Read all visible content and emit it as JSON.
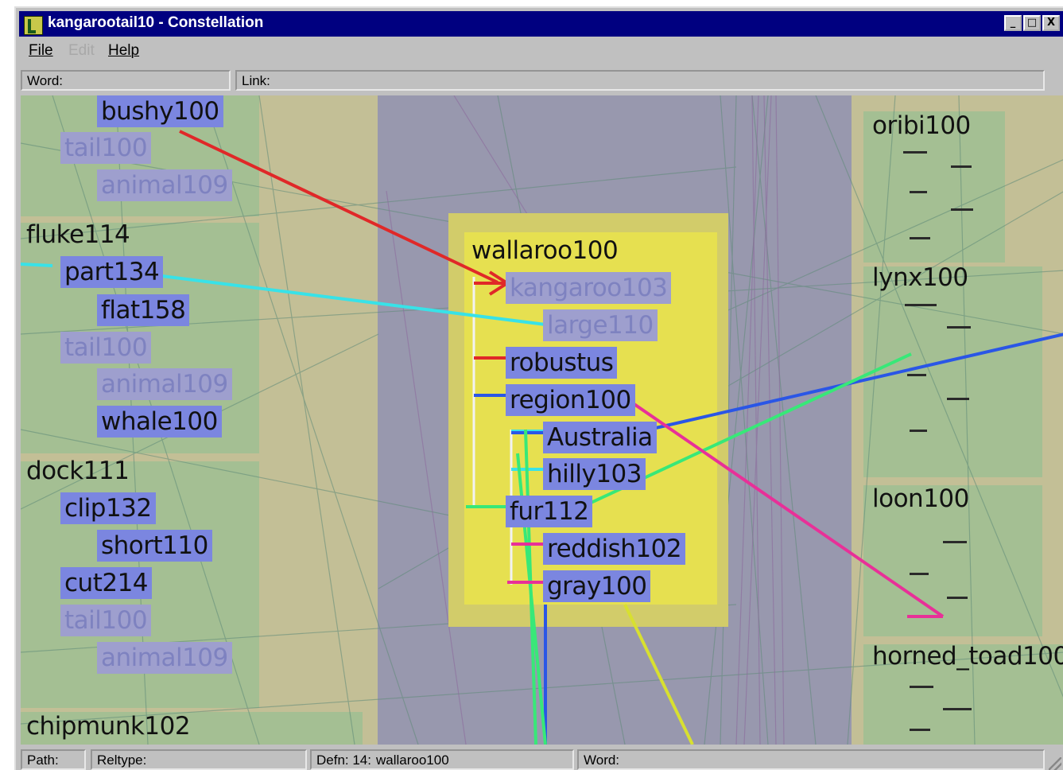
{
  "window": {
    "title": "kangarootail10 - Constellation",
    "controls": {
      "minimize": "_",
      "maximize": "□",
      "close": "X"
    }
  },
  "menubar": {
    "file": "File",
    "edit": "Edit",
    "help": "Help"
  },
  "fields": {
    "word_label": "Word:",
    "word_value": "",
    "link_label": "Link:",
    "link_value": ""
  },
  "canvas": {
    "colors": {
      "background": "#c3bf96",
      "center_panel": "#9898ae",
      "focus_outer": "#d2cc6a",
      "focus_inner": "#e6e050",
      "node_fill": "#7b86e0",
      "line_red": "#e02828",
      "line_cyan": "#38e2e8",
      "line_blue": "#2a56e6",
      "line_green": "#38e878",
      "line_magenta": "#e83098",
      "line_yellow": "#d8e030"
    },
    "left_nodes": {
      "bushy": "bushy100",
      "tail_a": "tail100",
      "animal_a": "animal109",
      "fluke": "fluke114",
      "part": "part134",
      "flat": "flat158",
      "tail_b": "tail100",
      "animal_b": "animal109",
      "whale": "whale100",
      "dock": "dock111",
      "clip": "clip132",
      "short": "short110",
      "cut": "cut214",
      "tail_c": "tail100",
      "animal_c": "animal109",
      "chipmunk": "chipmunk102"
    },
    "focus": {
      "title": "wallaroo100",
      "items": [
        "kangaroo103",
        "large110",
        "robustus",
        "region100",
        "Australia",
        "hilly103",
        "fur112",
        "reddish102",
        "gray100"
      ]
    },
    "right_nodes": {
      "oribi": "oribi100",
      "lynx": "lynx100",
      "loon": "loon100",
      "horned_toad": "horned_toad100"
    }
  },
  "statusbar": {
    "path_label": "Path:",
    "path_value": "",
    "reltype_label": "Reltype:",
    "reltype_value": "",
    "defn_label": "Defn: 14:",
    "defn_value": "wallaroo100",
    "word_label": "Word:",
    "word_value": ""
  }
}
